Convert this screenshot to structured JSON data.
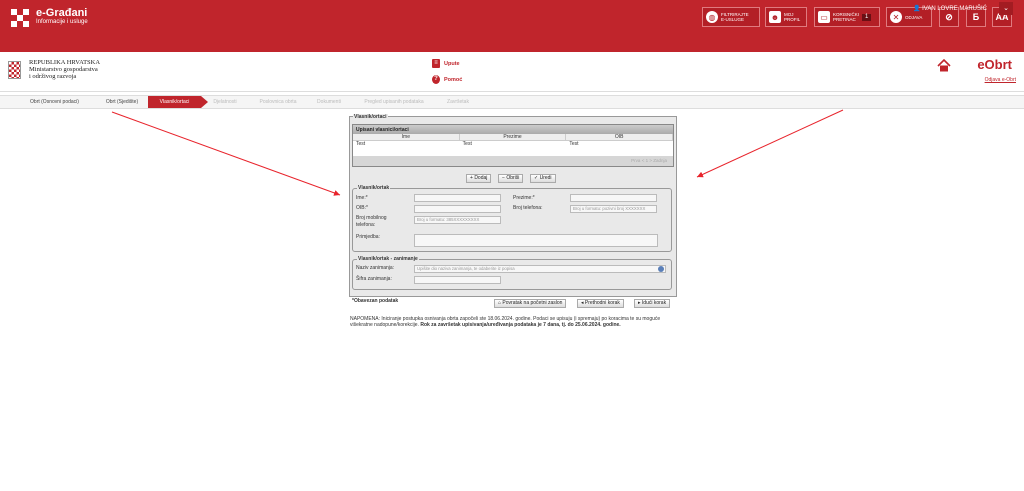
{
  "topbar": {
    "brand_title": "e-Građani",
    "brand_subtitle": "Informacije i usluge",
    "filter_label_1": "FILTRIRAJTE",
    "filter_label_2": "E-USLUGE",
    "profile_label_1": "MOJ",
    "profile_label_2": "PROFIL",
    "inbox_label_1": "KORISNIČKI",
    "inbox_label_2": "PRETINAC",
    "inbox_count": "1",
    "logout_label": "ODJAVA",
    "font_size_label": "AA",
    "dyslexia_label": "Ƃ"
  },
  "user": {
    "name": "IVAN LOVRE MARUŠIĆ"
  },
  "header": {
    "ministry_line1": "REPUBLIKA HRVATSKA",
    "ministry_line2": "Ministarstvo gospodarstva",
    "ministry_line3": "i održivog razvoja",
    "upute": "Upute",
    "pomoc": "Pomoć",
    "app_title": "eObrt",
    "app_logout": "Odjava e-Obrt"
  },
  "steps": [
    {
      "label": "Obrt (Osnovni podaci)",
      "state": "done"
    },
    {
      "label": "Obrt (Sjedište)",
      "state": "done"
    },
    {
      "label": "Vlasnik/ortaci",
      "state": "active"
    },
    {
      "label": "Djelatnosti",
      "state": "disabled"
    },
    {
      "label": "Poslovnica obrta",
      "state": "disabled"
    },
    {
      "label": "Dokumenti",
      "state": "disabled"
    },
    {
      "label": "Pregled upisanih podataka",
      "state": "disabled"
    },
    {
      "label": "Završetak",
      "state": "disabled"
    }
  ],
  "panel": {
    "legend": "Vlasnik/ortaci",
    "grid_title": "Upisani vlasnici/ortaci",
    "columns": [
      "Ime",
      "Prezime",
      "OIB"
    ],
    "rows": [
      [
        "Test",
        "Test",
        "Test"
      ]
    ],
    "pager_prev": "Prva",
    "pager_page": "1",
    "pager_last": "Zadnja",
    "add_button": "Dodaj",
    "delete_button": "Obriši",
    "edit_button": "Uredi",
    "owner_legend": "Vlasnik/ortak",
    "ime_label": "Ime:*",
    "prezime_label": "Prezime:*",
    "oib_label": "OIB:*",
    "telefon_label": "Broj telefona:",
    "telefon_placeholder": "Broj u formatu: pozivni broj XXXXXXX",
    "mobitel_label_1": "Broj mobilnog",
    "mobitel_label_2": "telefona:",
    "mobitel_placeholder": "Broj u formatu: 385XXXXXXXXX",
    "primjedba_label": "Primjedba:",
    "occupation_legend": "Vlasnik/ortak - zanimanje",
    "zanimanje_label": "Naziv zanimanja:",
    "zanimanje_placeholder": "Upišite dio naziva zanimanja, te odaberite iz popisa",
    "sifra_label": "Šifra zanimanja:",
    "required_note": "*Obavezan podatak",
    "back_start_button": "Povratak na početni zaslon",
    "prev_button": "Prethodni korak",
    "next_button": "Idući korak"
  },
  "note": {
    "text": "NAPOMENA: Iniciranje postupka osnivanja obrta započeli ste 18.06.2024. godine. Podaci se upisuju (i spremaju) po koracima te su moguće višekratne nadopune/korekcije.",
    "bold": "Rok za završetak upisivanja/uređivanja podataka je 7 dana, tj. do 25.06.2024. godine."
  },
  "colors": {
    "brand_red": "#c0252c",
    "annotation_red": "#e8242c"
  }
}
